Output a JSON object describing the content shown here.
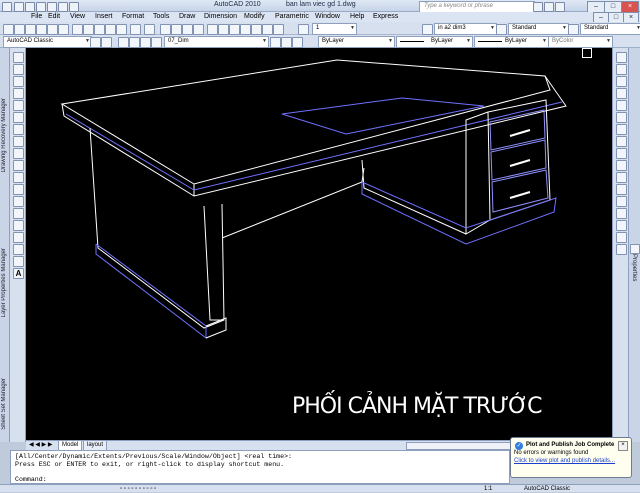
{
  "window": {
    "app_title": "AutoCAD 2010",
    "file_title": "ban lam viec gd 1.dwg"
  },
  "search": {
    "placeholder": "Type a keyword or phrase"
  },
  "menu": [
    "File",
    "Edit",
    "View",
    "Insert",
    "Format",
    "Tools",
    "Draw",
    "Dimension",
    "Modify",
    "Parametric",
    "Window",
    "Help",
    "Express"
  ],
  "toolbar1": {
    "layer_count": "1",
    "dim_style": "in a2 dim3",
    "text_style": "Standard",
    "table_style": "Standard"
  },
  "toolbar2": {
    "workspace": "AutoCAD Classic",
    "layer": "07_Dim",
    "color": "ByLayer",
    "linetype": "ByLayer",
    "lineweight": "ByLayer",
    "plotstyle": "ByColor"
  },
  "palettes": {
    "left": [
      "Drawing Recovery Manager",
      "Layer Properties Manager",
      "Sheet Set Manager"
    ],
    "right": [
      "Properties"
    ]
  },
  "drawing": {
    "caption": "PHỐI CẢNH MẶT TRƯỚC"
  },
  "tabs": [
    "Model",
    "layout"
  ],
  "command": {
    "line1": "[All/Center/Dynamic/Extents/Previous/Scale/Window/Object] <real time>:",
    "line2": "Press ESC or ENTER to exit, or right-click to display shortcut menu.",
    "prompt": "Command:"
  },
  "statusbar": {
    "scale": "1:1",
    "workspace": "AutoCAD Classic"
  },
  "notification": {
    "title": "Plot and Publish Job Complete",
    "message": "No errors or warnings found",
    "link": "Click to view plot and publish details..."
  },
  "colors": {
    "background": "#000000",
    "drawing_lines": "#ffffff",
    "highlight": "#7070ff"
  }
}
